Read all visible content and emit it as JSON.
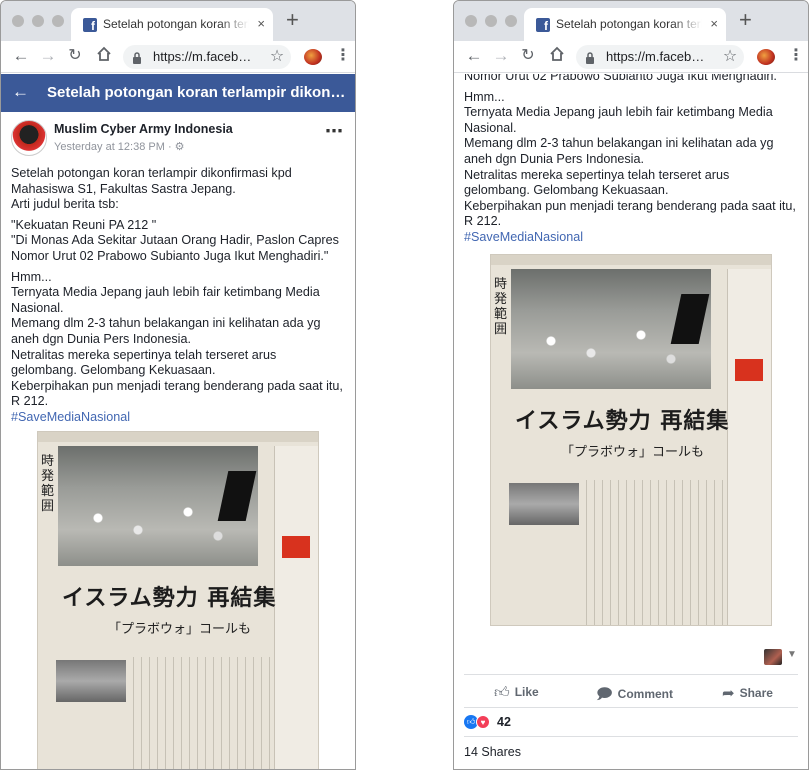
{
  "browser": {
    "tab_title": "Setelah potongan koran terlampir",
    "tab_close": "×",
    "new_tab": "+",
    "url": "https://m.faceb…"
  },
  "fb_header": {
    "title": "Setelah potongan koran terlampir dikon…"
  },
  "post": {
    "author": "Muslim Cyber Army Indonesia",
    "timestamp": "Yesterday at 12:38 PM · ⚙",
    "paragraph_1": "Setelah potongan koran terlampir dikonfirmasi kpd Mahasiswa S1, Fakultas Sastra Jepang.",
    "paragraph_2": "Arti judul berita tsb:",
    "quote_1": "\"Kekuatan Reuni PA 212 \"",
    "quote_2": "\"Di Monas Ada Sekitar Jutaan Orang Hadir, Paslon Capres Nomor Urut 02 Prabowo Subianto Juga Ikut Menghadiri.\"",
    "hmm": "Hmm...",
    "line_1": "Ternyata Media Jepang jauh lebih fair ketimbang Media Nasional.",
    "line_2": "Memang dlm 2-3 tahun belakangan ini kelihatan ada yg aneh dgn Dunia Pers Indonesia.",
    "line_3": "Netralitas mereka sepertinya telah terseret arus gelombang. Gelombang Kekuasaan.",
    "line_4": "Keberpihakan pun menjadi terang benderang pada saat itu, R 212.",
    "hashtag": "#SaveMediaNasional"
  },
  "newspaper": {
    "headline": "イスラム勢力 再結集",
    "subheadline": "「プラボウォ」コールも",
    "vertical": "時発範囲"
  },
  "right_window": {
    "top_cutoff": "Nomor Urut 02 Prabowo Subianto Juga Ikut Menghadiri.\"",
    "actions": {
      "like": "Like",
      "comment": "Comment",
      "share": "Share"
    },
    "reaction_count": "42",
    "shares": "14 Shares"
  },
  "colors": {
    "facebook_blue": "#3b5998",
    "hashtag": "#4267b2",
    "like": "#1877f2",
    "love": "#f33e58"
  }
}
